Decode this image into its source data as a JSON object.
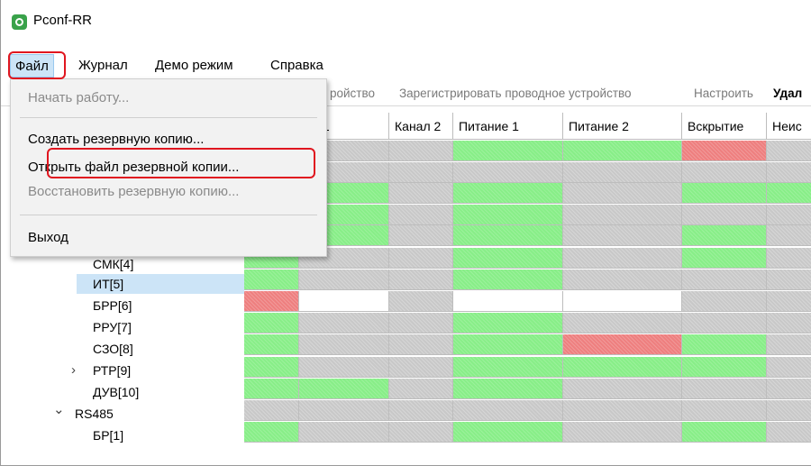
{
  "app": {
    "title": "Pconf-RR"
  },
  "menubar": [
    {
      "label": "Файл"
    },
    {
      "label": "Журнал"
    },
    {
      "label": "Демо режим"
    },
    {
      "label": "Справка"
    }
  ],
  "file_menu": {
    "items": [
      {
        "label": "Начать работу...",
        "disabled": true
      },
      {
        "label": "Создать резервную копию...",
        "disabled": false
      },
      {
        "label": "Открыть файл резервной копии...",
        "disabled": false,
        "highlighted": true
      },
      {
        "label": "Восстановить резервную копию...",
        "disabled": true
      },
      {
        "label": "Выход",
        "disabled": false
      }
    ]
  },
  "toolbar": {
    "items": [
      {
        "label": "ройство"
      },
      {
        "label": "Зарегистрировать проводное устройство"
      },
      {
        "label": "Настроить"
      },
      {
        "label": "Удал"
      }
    ]
  },
  "columns": [
    {
      "label": ""
    },
    {
      "label": "ал 1"
    },
    {
      "label": "Канал 2"
    },
    {
      "label": "Питание 1"
    },
    {
      "label": "Питание 2"
    },
    {
      "label": "Вскрытие"
    },
    {
      "label": "Неис"
    }
  ],
  "tree": [
    {
      "label": "СМК[4]"
    },
    {
      "label": "ИТ[5]",
      "selected": true
    },
    {
      "label": "БРР[6]"
    },
    {
      "label": "РРУ[7]"
    },
    {
      "label": "СЗО[8]"
    },
    {
      "label": "РТР[9]",
      "expander": "›"
    },
    {
      "label": "ДУВ[10]"
    },
    {
      "label": "RS485",
      "expander": "⌄"
    },
    {
      "label": "БР[1]"
    }
  ],
  "status_colors": {
    "ok": "#88ee88",
    "inactive": "#c8c8c8",
    "alarm": "#ee7f7f",
    "empty": "#ffffff",
    "selection": "#cce4f7",
    "highlight": "#e0161f"
  },
  "grid_rows": [
    [
      "g",
      "y",
      "y",
      "g",
      "g",
      "r",
      "y"
    ],
    [
      "y",
      "y",
      "y",
      "y",
      "y",
      "y",
      "y"
    ],
    [
      "g",
      "g",
      "y",
      "g",
      "y",
      "g",
      "g"
    ],
    [
      "g",
      "g",
      "y",
      "g",
      "y",
      "y",
      "y"
    ],
    [
      "g",
      "g",
      "y",
      "g",
      "y",
      "g",
      "y"
    ],
    [
      "g",
      "y",
      "y",
      "g",
      "y",
      "g",
      "y"
    ],
    [
      "g",
      "y",
      "y",
      "g",
      "y",
      "y",
      "y"
    ],
    [
      "r",
      "w",
      "y",
      "w",
      "w",
      "y",
      "y"
    ],
    [
      "g",
      "y",
      "y",
      "g",
      "y",
      "y",
      "y"
    ],
    [
      "g",
      "y",
      "y",
      "g",
      "r",
      "g",
      "y"
    ],
    [
      "g",
      "y",
      "y",
      "g",
      "g",
      "g",
      "y"
    ],
    [
      "g",
      "g",
      "y",
      "g",
      "y",
      "y",
      "y"
    ],
    [
      "y",
      "y",
      "y",
      "y",
      "y",
      "y",
      "y"
    ],
    [
      "g",
      "y",
      "y",
      "g",
      "y",
      "g",
      "y"
    ]
  ]
}
